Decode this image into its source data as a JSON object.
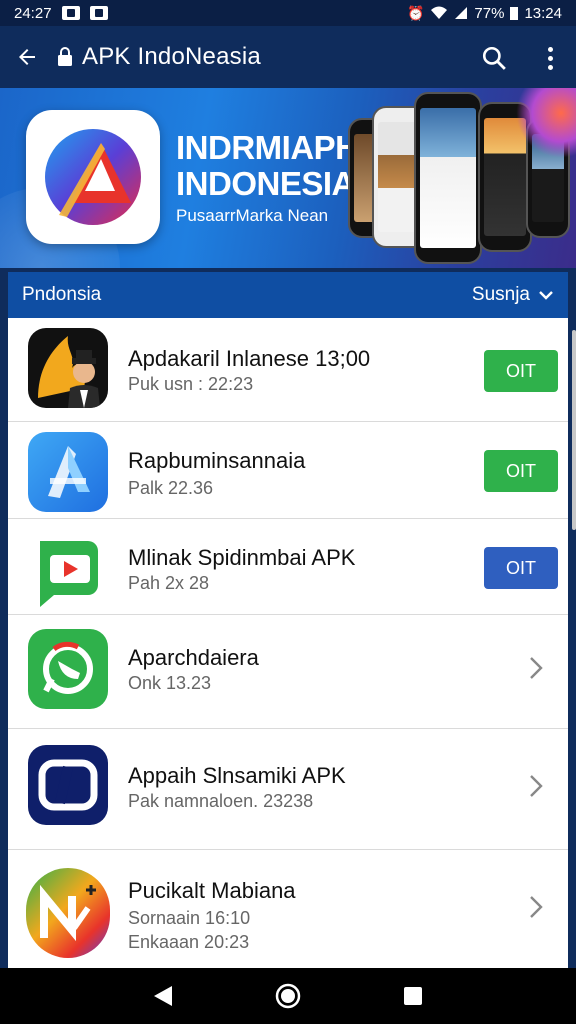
{
  "status_bar": {
    "time_left": "24:27",
    "battery": "77%",
    "time_right": "13:24"
  },
  "app_bar": {
    "title": "APK IndoNeasia"
  },
  "banner": {
    "title_line1": "INDRMIAPH",
    "title_line2": "INDONESIA",
    "subtitle": "PusaarrMarka Nean"
  },
  "section": {
    "label": "Pndonsia",
    "sort_label": "Susnja"
  },
  "apps": [
    {
      "name": "Apdakaril Inlanese 13;00",
      "meta1": "Puk usn : 22:23",
      "meta2": "",
      "action": "OIT",
      "action_color": "#2fb14b"
    },
    {
      "name": "Rapbuminsannaia",
      "meta1": "Palk 22.36",
      "meta2": "",
      "action": "OIT",
      "action_color": "#2fb14b"
    },
    {
      "name": "Mlinak Spidinmbai APK",
      "meta1": "Pah 2x 28",
      "meta2": "",
      "action": "OIT",
      "action_color": "#2f5fbf"
    },
    {
      "name": "Aparchdaiera",
      "meta1": "Onk 13.23",
      "meta2": "",
      "action": "",
      "action_color": ""
    },
    {
      "name": "Appaih Slnsamiki APK",
      "meta1": "Pak namnaloen. 23238",
      "meta2": "",
      "action": "",
      "action_color": ""
    },
    {
      "name": "Pucikalt Mabiana",
      "meta1": "Sornaain 16:10",
      "meta2": "Enkaaan 20:23",
      "action": "",
      "action_color": ""
    }
  ],
  "colors": {
    "appbar": "#0f2c5c",
    "section": "#0f4ea3",
    "green": "#2fb14b",
    "blue": "#2f5fbf"
  },
  "icons": [
    "back-arrow-icon",
    "lock-icon",
    "search-icon",
    "more-vert-icon",
    "chevron-down-icon",
    "chevron-right-icon",
    "nav-back-icon",
    "nav-home-icon",
    "nav-recents-icon"
  ]
}
